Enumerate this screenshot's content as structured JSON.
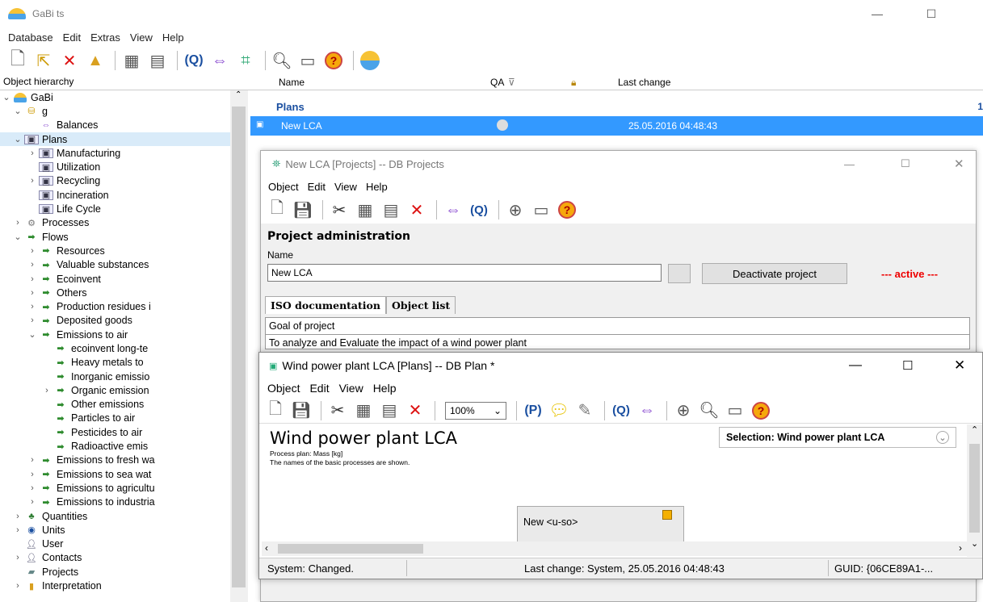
{
  "main_window": {
    "title": "GaBi ts",
    "minimize": "—",
    "maximize": "☐"
  },
  "menu": [
    "Database",
    "Edit",
    "Extras",
    "View",
    "Help"
  ],
  "tree": {
    "header": "Object hierarchy",
    "items": [
      {
        "label": "GaBi",
        "level": 0,
        "chev": "⌄"
      },
      {
        "label": "g",
        "level": 1,
        "chev": "⌄"
      },
      {
        "label": "Balances",
        "level": 2,
        "chev": ""
      },
      {
        "label": "Plans",
        "level": 1,
        "chev": "⌄"
      },
      {
        "label": "Manufacturing",
        "level": 2,
        "chev": "›"
      },
      {
        "label": "Utilization",
        "level": 2,
        "chev": ""
      },
      {
        "label": "Recycling",
        "level": 2,
        "chev": "›"
      },
      {
        "label": "Incineration",
        "level": 2,
        "chev": ""
      },
      {
        "label": "Life Cycle",
        "level": 2,
        "chev": ""
      },
      {
        "label": "Processes",
        "level": 1,
        "chev": "›"
      },
      {
        "label": "Flows",
        "level": 1,
        "chev": "⌄"
      },
      {
        "label": "Resources",
        "level": 2,
        "chev": "›"
      },
      {
        "label": "Valuable substances",
        "level": 2,
        "chev": "›"
      },
      {
        "label": "Ecoinvent",
        "level": 2,
        "chev": "›"
      },
      {
        "label": "Others",
        "level": 2,
        "chev": "›"
      },
      {
        "label": "Production residues i",
        "level": 2,
        "chev": "›"
      },
      {
        "label": "Deposited goods",
        "level": 2,
        "chev": "›"
      },
      {
        "label": "Emissions to air",
        "level": 2,
        "chev": "⌄"
      },
      {
        "label": "ecoinvent long-te",
        "level": 3,
        "chev": ""
      },
      {
        "label": "Heavy metals to",
        "level": 3,
        "chev": ""
      },
      {
        "label": "Inorganic emissio",
        "level": 3,
        "chev": ""
      },
      {
        "label": "Organic emission",
        "level": 3,
        "chev": "›"
      },
      {
        "label": "Other emissions",
        "level": 3,
        "chev": ""
      },
      {
        "label": "Particles to air",
        "level": 3,
        "chev": ""
      },
      {
        "label": "Pesticides to air",
        "level": 3,
        "chev": ""
      },
      {
        "label": "Radioactive emis",
        "level": 3,
        "chev": ""
      },
      {
        "label": "Emissions to fresh wa",
        "level": 2,
        "chev": "›"
      },
      {
        "label": "Emissions to sea wat",
        "level": 2,
        "chev": "›"
      },
      {
        "label": "Emissions to agricultu",
        "level": 2,
        "chev": "›"
      },
      {
        "label": "Emissions to industria",
        "level": 2,
        "chev": "›"
      },
      {
        "label": "Quantities",
        "level": 1,
        "chev": "›"
      },
      {
        "label": "Units",
        "level": 1,
        "chev": "›"
      },
      {
        "label": "User",
        "level": 1,
        "chev": ""
      },
      {
        "label": "Contacts",
        "level": 1,
        "chev": "›"
      },
      {
        "label": "Projects",
        "level": 1,
        "chev": ""
      },
      {
        "label": "Interpretation",
        "level": 1,
        "chev": "›"
      }
    ]
  },
  "list": {
    "col_name": "Name",
    "col_qa": "QA",
    "col_last_change": "Last change",
    "group_label": "Plans",
    "group_count": "1",
    "selected_name": "New LCA",
    "selected_date": "25.05.2016 04:48:43"
  },
  "project_window": {
    "title": "New LCA [Projects] -- DB Projects",
    "menu": [
      "Object",
      "Edit",
      "View",
      "Help"
    ],
    "section_title": "Project administration",
    "name_label": "Name",
    "name_value": "New LCA",
    "deactivate_label": "Deactivate project",
    "status": "--- active ---",
    "tab_iso": "ISO documentation",
    "tab_objects": "Object list",
    "goal_label": "Goal of project",
    "goal_text": "To analyze and Evaluate the impact of a wind power plant"
  },
  "plan_window": {
    "title": "Wind power plant LCA [Plans] -- DB Plan *",
    "menu": [
      "Object",
      "Edit",
      "View",
      "Help"
    ],
    "zoom": "100%",
    "heading": "Wind power plant LCA",
    "sub1": "Process plan: Mass [kg]",
    "sub2": "The names of the basic processes are shown.",
    "selection": "Selection: Wind power plant LCA",
    "process_label": "New <u-so>",
    "status_left": "System: Changed.",
    "status_mid": "Last change: System, 25.05.2016 04:48:43",
    "status_right": "GUID: {06CE89A1-..."
  }
}
